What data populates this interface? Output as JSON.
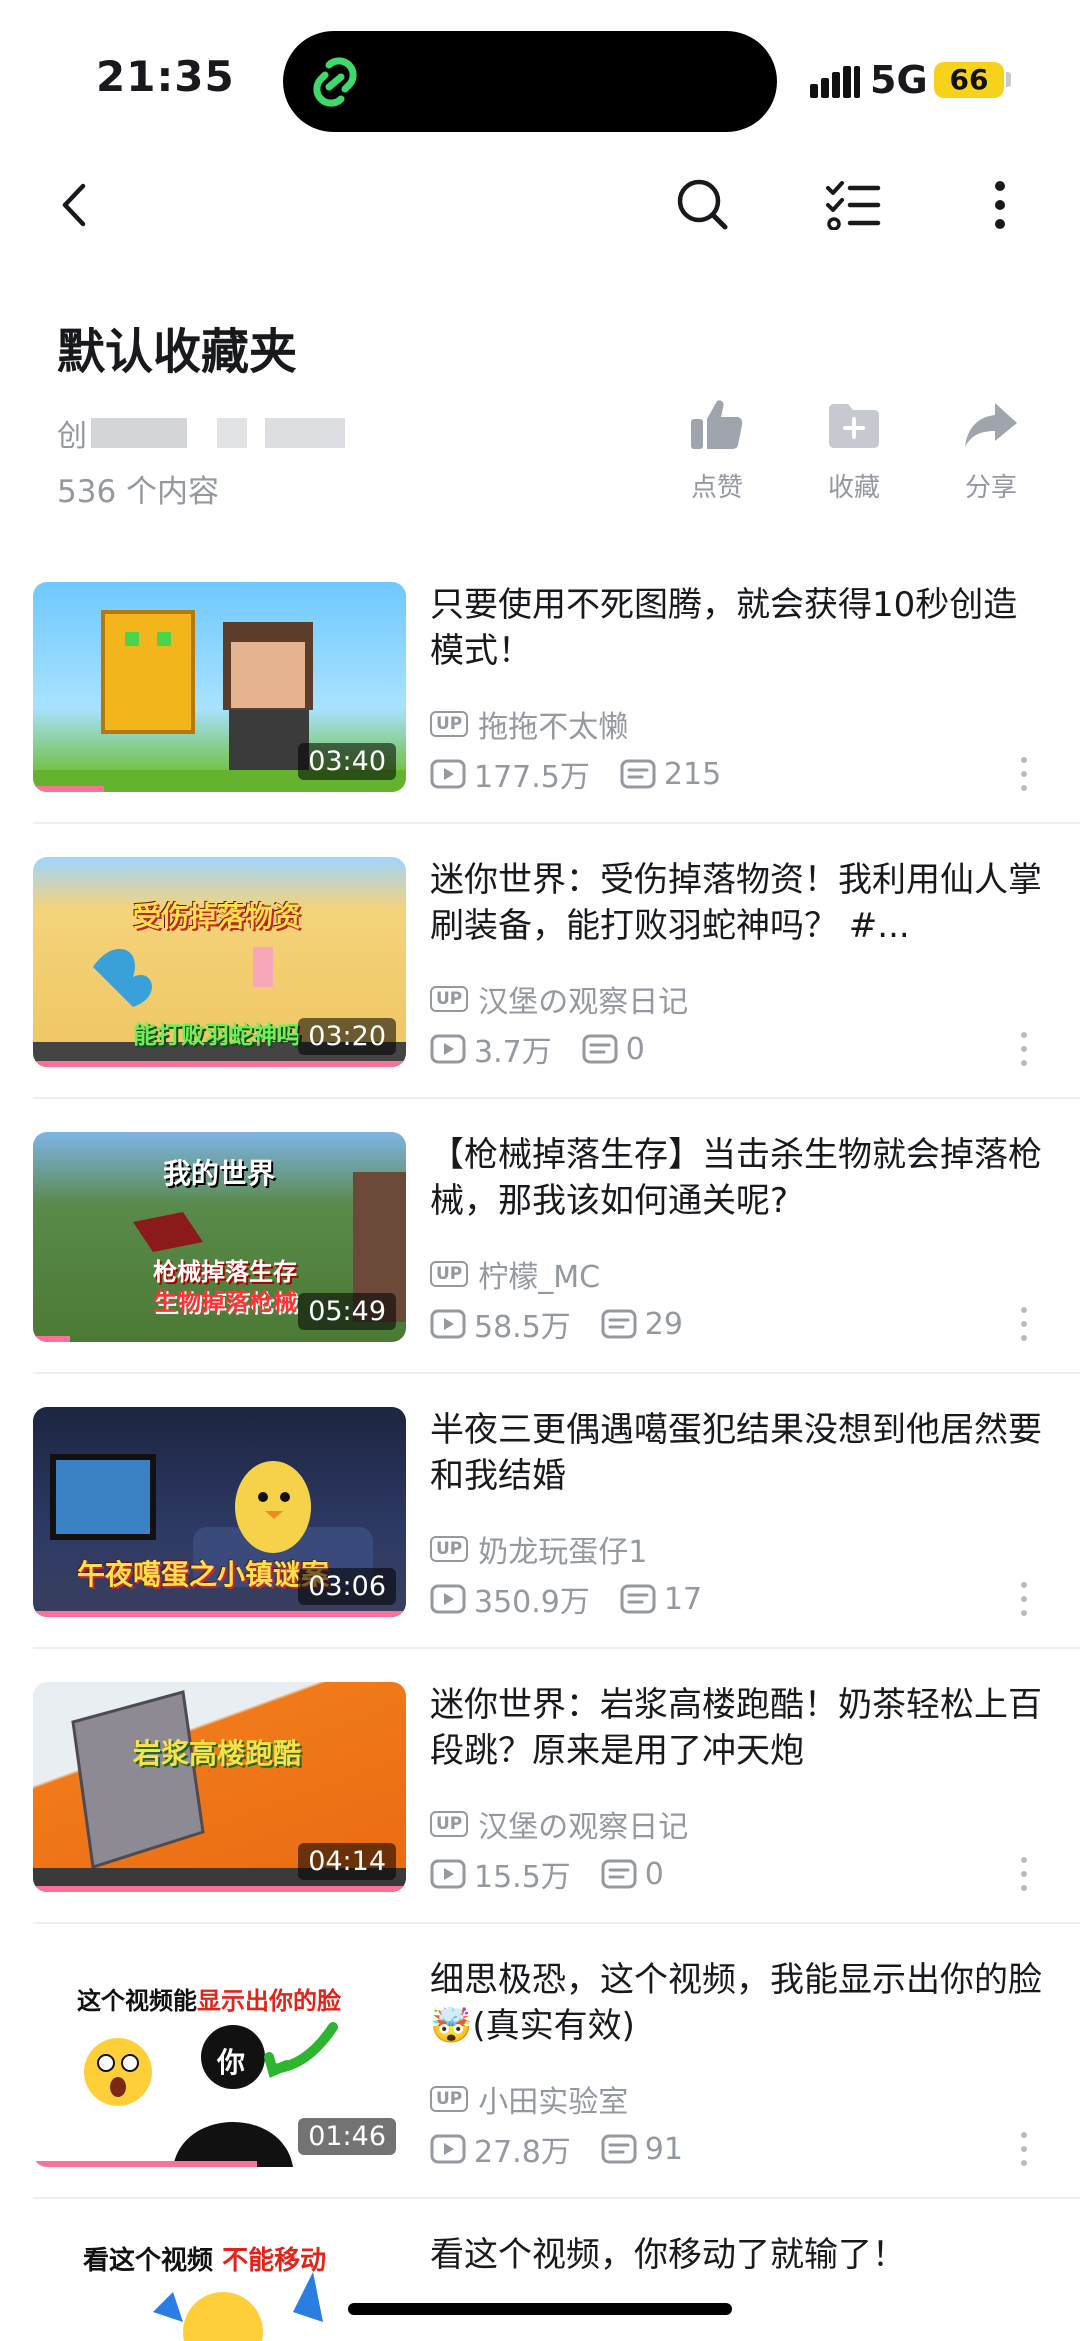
{
  "status_bar": {
    "time": "21:35",
    "network": "5G",
    "battery": "66"
  },
  "colors": {
    "accent_pink": "#fb7299",
    "text_primary": "#18191c",
    "text_secondary": "#9499a0",
    "island_icon": "#3fd96b"
  },
  "nav": {
    "icons": [
      "back-icon",
      "search-icon",
      "manage-list-icon",
      "more-icon"
    ]
  },
  "folder": {
    "title": "默认收藏夹",
    "creator_prefix": "创",
    "count": "536 个内容"
  },
  "actions": [
    {
      "label": "点赞",
      "icon": "thumbs-up-icon"
    },
    {
      "label": "收藏",
      "icon": "favorite-folder-icon"
    },
    {
      "label": "分享",
      "icon": "share-icon"
    }
  ],
  "videos": [
    {
      "title": "只要使用不死图腾，就会获得10秒创造模式！",
      "up": "拖拖不太懒",
      "plays": "177.5万",
      "comments": "215",
      "duration": "03:40",
      "progress": 0.19,
      "thumb_text": ""
    },
    {
      "title": "迷你世界：受伤掉落物资！我利用仙人掌刷装备，能打败羽蛇神吗？ #...",
      "up": "汉堡の观察日记",
      "plays": "3.7万",
      "comments": "0",
      "duration": "03:20",
      "progress": 1.0,
      "thumb_text": "受伤掉落物资",
      "thumb_text2": "能打败羽蛇神吗"
    },
    {
      "title": "【枪械掉落生存】当击杀生物就会掉落枪械，那我该如何通关呢?",
      "up": "柠檬_MC",
      "plays": "58.5万",
      "comments": "29",
      "duration": "05:49",
      "progress": 0.1,
      "thumb_text": "我的世界",
      "thumb_text2": "枪械掉落生存",
      "thumb_text3": "生物掉落枪械"
    },
    {
      "title": "半夜三更偶遇噶蛋犯结果没想到他居然要和我结婚",
      "up": "奶龙玩蛋仔1",
      "plays": "350.9万",
      "comments": "17",
      "duration": "03:06",
      "progress": 1.0,
      "thumb_text": "午夜噶蛋之小镇谜案"
    },
    {
      "title": "迷你世界：岩浆高楼跑酷！奶茶轻松上百段跳？原来是用了冲天炮",
      "up": "汉堡の观察日记",
      "plays": "15.5万",
      "comments": "0",
      "duration": "04:14",
      "progress": 1.0,
      "thumb_text": "岩浆高楼跑酷"
    },
    {
      "title": "细思极恐，这个视频，我能显示出你的脸🤯(真实有效)",
      "up": "小田实验室",
      "plays": "27.8万",
      "comments": "91",
      "duration": "01:46",
      "progress": 0.6,
      "thumb_text": "这个视频能",
      "thumb_text2": "显示出你的脸",
      "thumb_text3": "你"
    },
    {
      "title": "看这个视频，你移动了就输了！",
      "thumb_text": "看这个视频",
      "thumb_text2": "不能移动"
    }
  ]
}
